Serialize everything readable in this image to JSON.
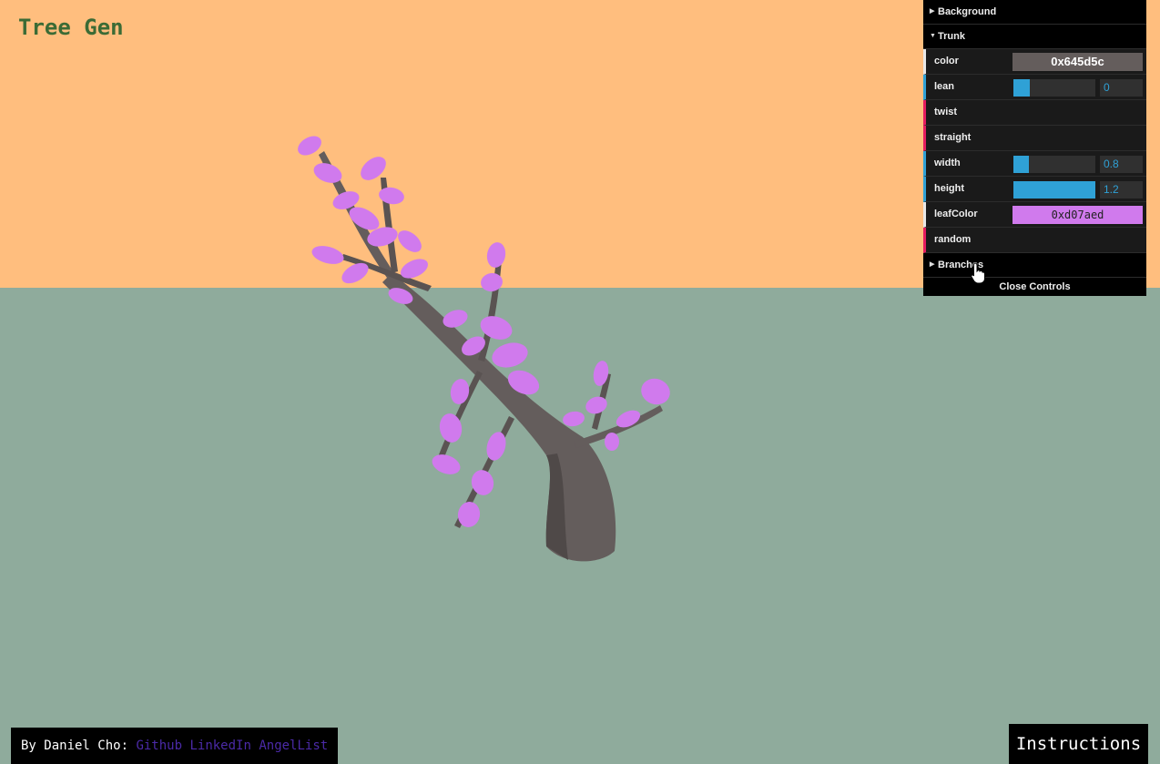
{
  "app": {
    "title": "Tree Gen"
  },
  "scene": {
    "sky_color": "#ffbe7e",
    "ground_color": "#8fab9c",
    "trunk_color": "#645d5c",
    "leaf_color": "#d07aed"
  },
  "gui": {
    "folders": [
      {
        "label": "Background",
        "open": false
      },
      {
        "label": "Trunk",
        "open": true
      },
      {
        "label": "Branches",
        "open": false
      }
    ],
    "trunk": {
      "color": {
        "label": "color",
        "value": "0x645d5c"
      },
      "lean": {
        "label": "lean",
        "value": "0",
        "fraction": 0.2
      },
      "twist": {
        "label": "twist"
      },
      "straight": {
        "label": "straight"
      },
      "width": {
        "label": "width",
        "value": "0.8",
        "fraction": 0.19
      },
      "height": {
        "label": "height",
        "value": "1.2",
        "fraction": 1.0
      },
      "leafColor": {
        "label": "leafColor",
        "value": "0xd07aed"
      },
      "random": {
        "label": "random"
      }
    },
    "close_label": "Close Controls"
  },
  "footer": {
    "by": "By Daniel Cho:",
    "links": [
      "Github",
      "LinkedIn",
      "AngelList"
    ]
  },
  "instructions_label": "Instructions"
}
